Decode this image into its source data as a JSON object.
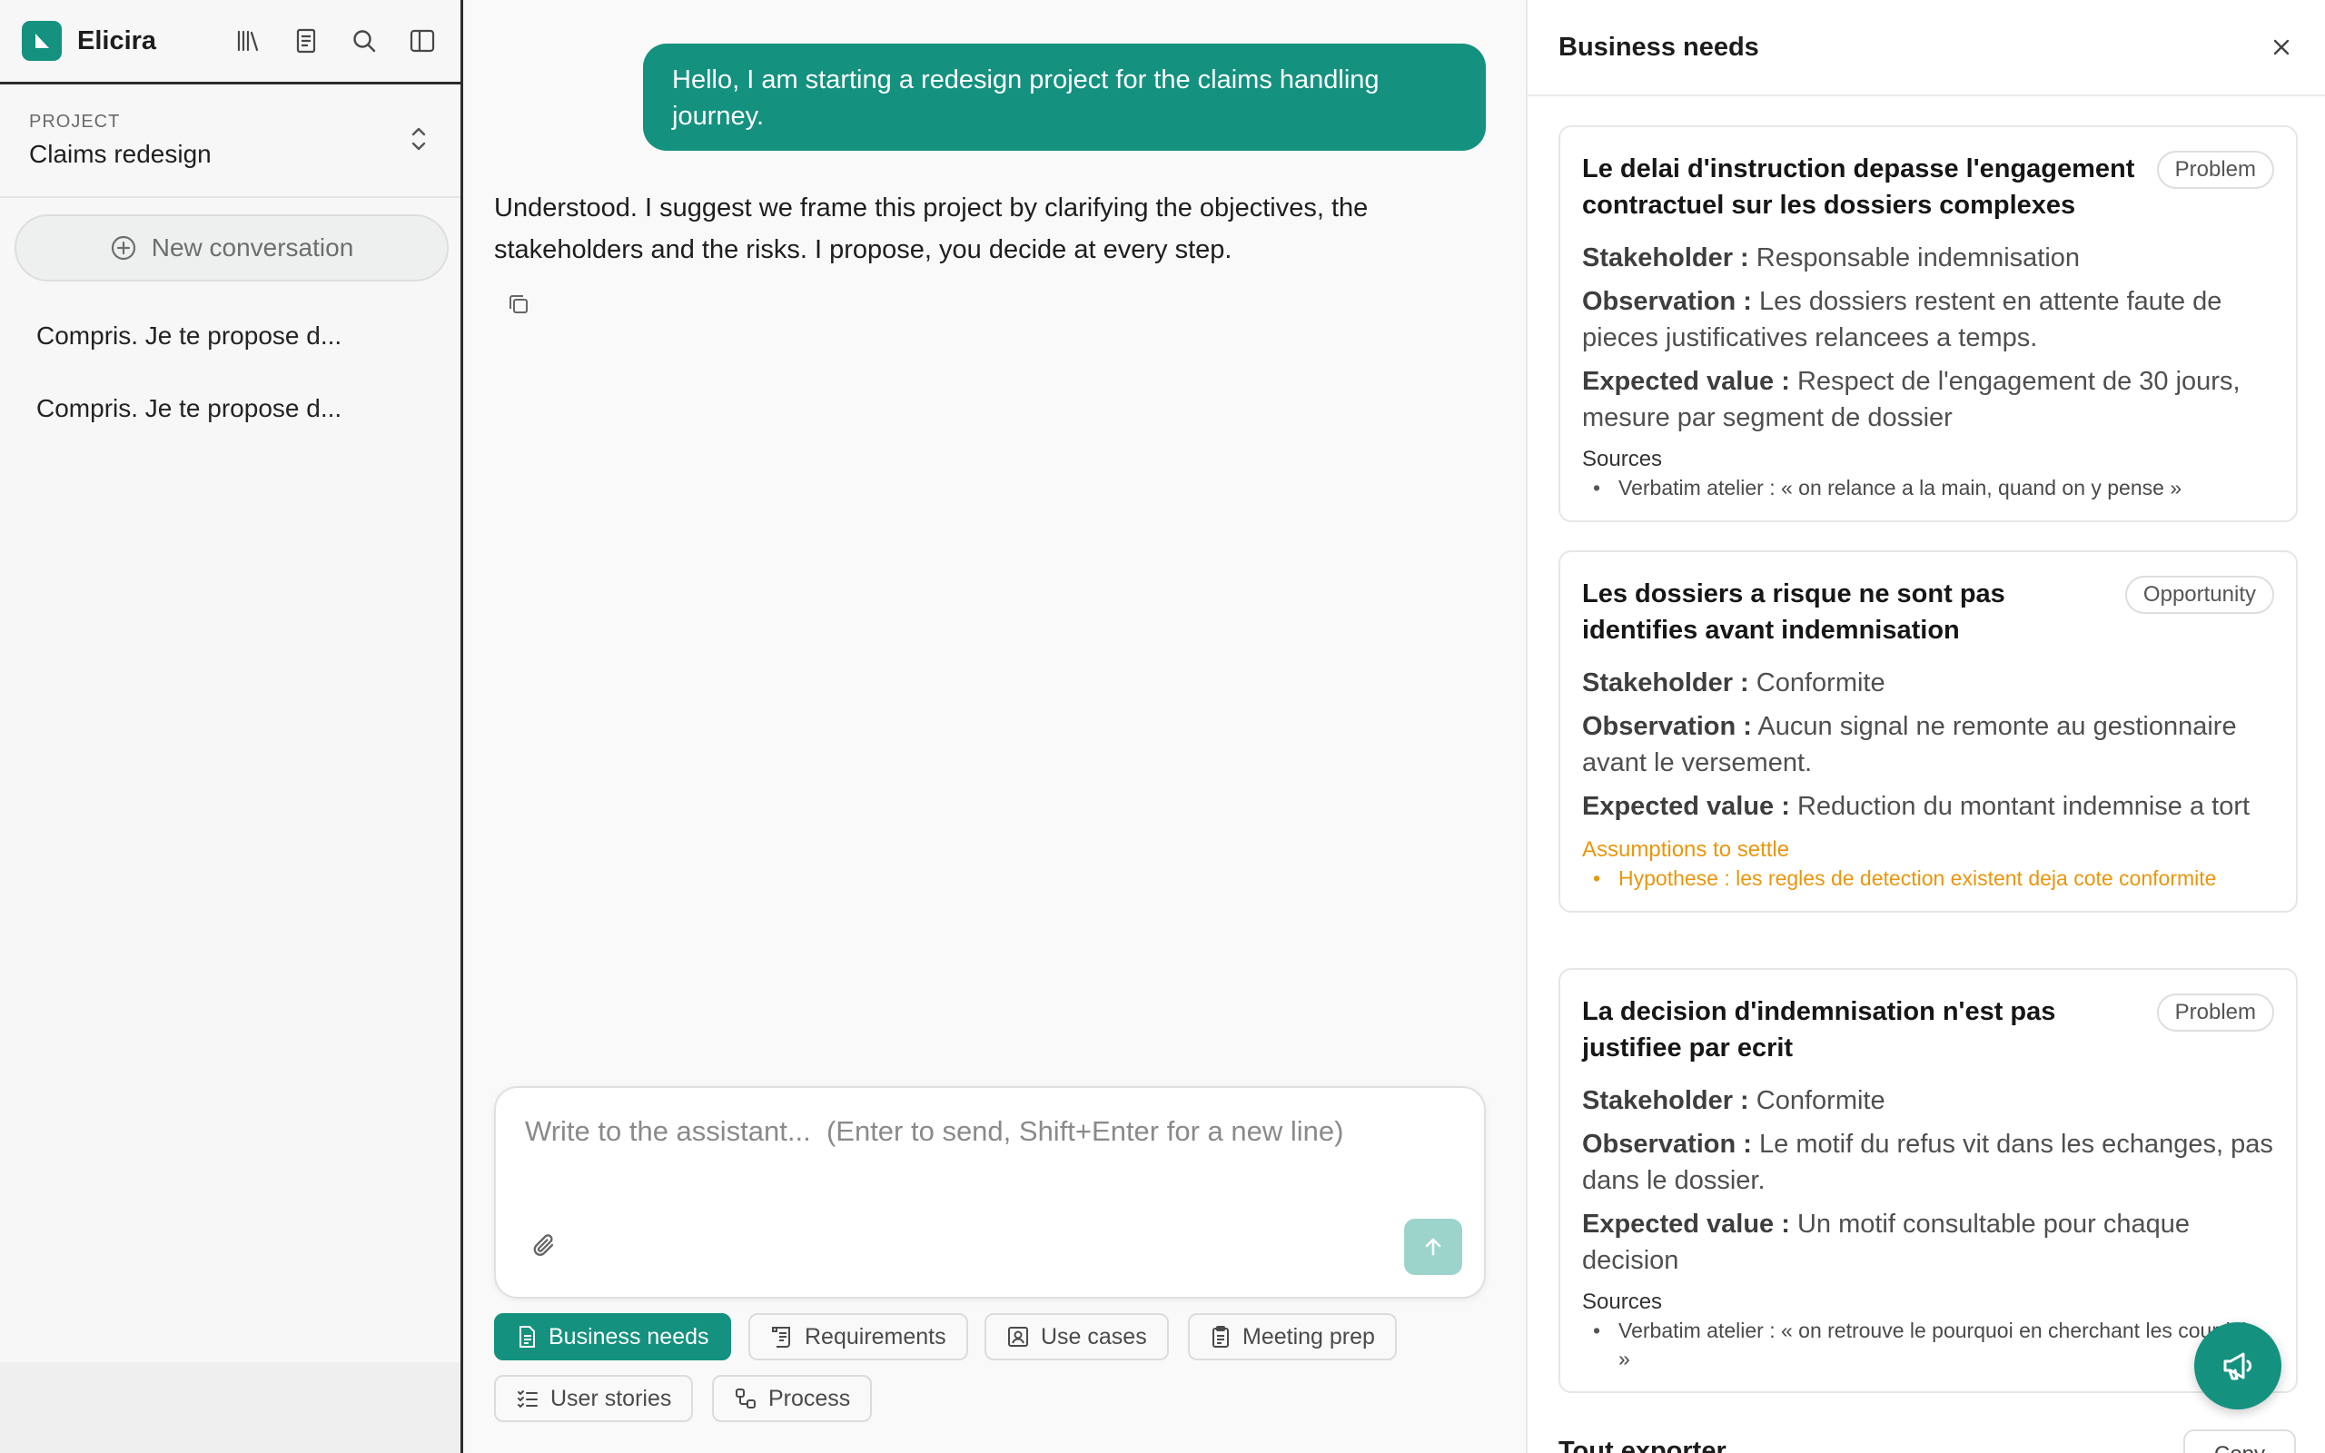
{
  "app": {
    "name": "Elicira"
  },
  "project": {
    "label": "PROJECT",
    "name": "Claims redesign"
  },
  "sidebar": {
    "new_conversation": "New conversation",
    "conversations": [
      "Compris. Je te propose d...",
      "Compris. Je te propose d..."
    ]
  },
  "chat": {
    "user_message": "Hello, I am starting a redesign project for the claims handling journey.",
    "assistant_message": "Understood. I suggest we frame this project by clarifying the objectives, the stakeholders and the risks. I propose, you decide at every step.",
    "composer_placeholder": "Write to the assistant...  (Enter to send, Shift+Enter for a new line)"
  },
  "chips": [
    "Business needs",
    "Requirements",
    "Use cases",
    "Meeting prep",
    "User stories",
    "Process"
  ],
  "panel": {
    "title": "Business needs",
    "labels": {
      "stakeholder": "Stakeholder :",
      "observation": "Observation :",
      "expected": "Expected value :",
      "sources": "Sources",
      "assumptions": "Assumptions to settle"
    },
    "cards": [
      {
        "title": "Le delai d'instruction depasse l'engagement contractuel sur les dossiers complexes",
        "badge": "Problem",
        "stakeholder": "Responsable indemnisation",
        "observation": "Les dossiers restent en attente faute de pieces justificatives relancees a temps.",
        "expected": "Respect de l'engagement de 30 jours, mesure par segment de dossier",
        "source": "Verbatim atelier : « on relance a la main, quand on y pense »"
      },
      {
        "title": "Les dossiers a risque ne sont pas identifies avant indemnisation",
        "badge": "Opportunity",
        "stakeholder": "Conformite",
        "observation": "Aucun signal ne remonte au gestionnaire avant le versement.",
        "expected": "Reduction du montant indemnise a tort",
        "assumption": "Hypothese : les regles de detection existent deja cote conformite"
      },
      {
        "title": "La decision d'indemnisation n'est pas justifiee par ecrit",
        "badge": "Problem",
        "stakeholder": "Conformite",
        "observation": "Le motif du refus vit dans les echanges, pas dans le dossier.",
        "expected": "Un motif consultable pour chaque decision",
        "source": "Verbatim atelier : « on retrouve le pourquoi en cherchant les courriels »"
      }
    ],
    "export_title": "Tout exporter",
    "export_button": "Copy"
  },
  "colors": {
    "accent": "#14917f",
    "assumption": "#e8960c"
  }
}
